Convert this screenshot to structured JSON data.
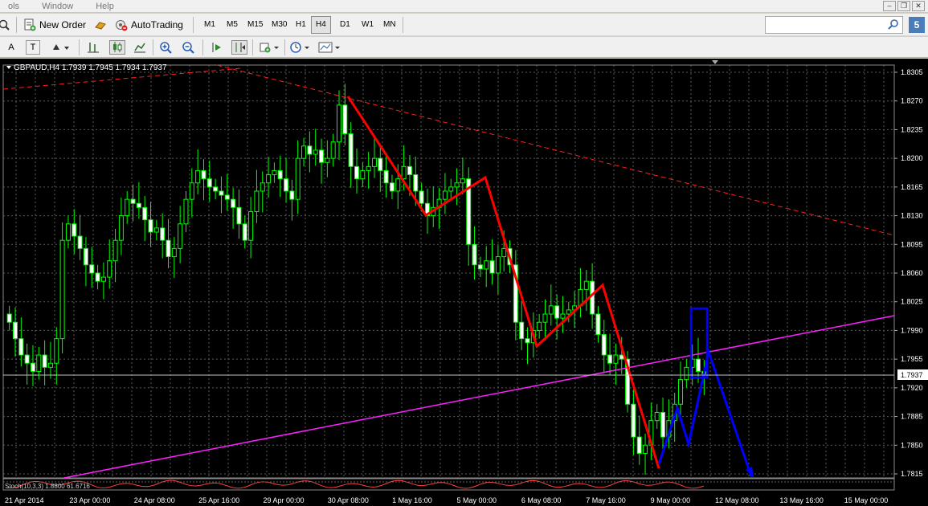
{
  "menu": {
    "items": [
      "ols",
      "Window",
      "Help"
    ]
  },
  "toolbar": {
    "new_order": "New Order",
    "autotrading": "AutoTrading",
    "timeframes": [
      "M1",
      "M5",
      "M15",
      "M30",
      "H1",
      "H4",
      "D1",
      "W1",
      "MN"
    ],
    "active_timeframe": "H4",
    "search_placeholder": "",
    "badge": "5"
  },
  "toolbar2": {
    "text_tool": "A",
    "label_tool": "T"
  },
  "chart": {
    "title": "GBPAUD,H4  1.7939 1.7945 1.7934 1.7937",
    "current_price_label": "1.7937",
    "indicator_label": "Stoch(10,3,3) 1.8800 61.6716",
    "colors": {
      "background": "#000000",
      "grid": "#5a5a5a",
      "candle": "#00ff00",
      "bull_body": "#000000",
      "bear_body": "#ffffff",
      "trendline_red": "#ff2020",
      "zigzag_red": "#ff0000",
      "support_line": "#ff20ff",
      "projection_blue": "#0000ff"
    }
  },
  "chart_data": {
    "type": "candlestick",
    "symbol": "GBPAUD",
    "timeframe": "H4",
    "ohlc": [
      1.7939,
      1.7945,
      1.7934,
      1.7937
    ],
    "ylim": [
      1.7815,
      1.8305
    ],
    "yticks": [
      1.8305,
      1.827,
      1.8235,
      1.82,
      1.8165,
      1.813,
      1.8095,
      1.806,
      1.8025,
      1.799,
      1.7955,
      1.792,
      1.7885,
      1.785,
      1.7815
    ],
    "xticks": [
      "21 Apr 2014",
      "23 Apr 00:00",
      "24 Apr 08:00",
      "25 Apr 16:00",
      "29 Apr 00:00",
      "30 Apr 08:00",
      "1 May 16:00",
      "5 May 00:00",
      "6 May 08:00",
      "7 May 16:00",
      "9 May 00:00",
      "12 May 08:00",
      "13 May 16:00",
      "15 May 00:00"
    ],
    "current_price": 1.7937,
    "closes": [
      1.8,
      1.798,
      1.796,
      1.795,
      1.794,
      1.796,
      1.7945,
      1.795,
      1.798,
      1.81,
      1.812,
      1.8105,
      1.809,
      1.807,
      1.806,
      1.805,
      1.8055,
      1.8075,
      1.81,
      1.813,
      1.815,
      1.8145,
      1.814,
      1.8125,
      1.811,
      1.8115,
      1.81,
      1.808,
      1.809,
      1.812,
      1.815,
      1.817,
      1.8185,
      1.8175,
      1.8165,
      1.816,
      1.8155,
      1.815,
      1.814,
      1.812,
      1.81,
      1.8135,
      1.816,
      1.817,
      1.818,
      1.8185,
      1.8175,
      1.816,
      1.815,
      1.82,
      1.8215,
      1.8205,
      1.821,
      1.8195,
      1.82,
      1.822,
      1.8265,
      1.823,
      1.819,
      1.8175,
      1.8185,
      1.819,
      1.82,
      1.8185,
      1.817,
      1.816,
      1.8175,
      1.819,
      1.818,
      1.816,
      1.8145,
      1.813,
      1.814,
      1.815,
      1.816,
      1.8165,
      1.817,
      1.8175,
      1.8095,
      1.807,
      1.8065,
      1.8075,
      1.806,
      1.808,
      1.809,
      1.807,
      1.8,
      1.798,
      1.7975,
      1.799,
      1.8,
      1.801,
      1.802,
      1.8005,
      1.801,
      1.8015,
      1.802,
      1.804,
      1.805,
      1.801,
      1.7985,
      1.796,
      1.795,
      1.796,
      1.7955,
      1.79,
      1.786,
      1.784,
      1.785,
      1.788,
      1.789,
      1.786,
      1.788,
      1.79,
      1.793,
      1.7945,
      1.7955,
      1.794,
      1.7937
    ],
    "zigzag_red": [
      [
        1.828,
        "peak"
      ],
      [
        1.813,
        "trough"
      ],
      [
        1.818,
        "peak"
      ],
      [
        1.7975,
        "trough"
      ],
      [
        1.805,
        "peak"
      ],
      [
        1.7825,
        "trough"
      ]
    ],
    "projection_blue": [
      [
        1.783
      ],
      [
        1.79
      ],
      [
        1.785
      ],
      [
        1.7965
      ],
      [
        1.781
      ]
    ],
    "highlight_box": [
      1.802,
      1.7935
    ],
    "support_line": [
      [
        1.781
      ],
      [
        1.8005
      ]
    ],
    "resistance_line": [
      [
        1.8285
      ],
      [
        1.8105
      ]
    ]
  }
}
